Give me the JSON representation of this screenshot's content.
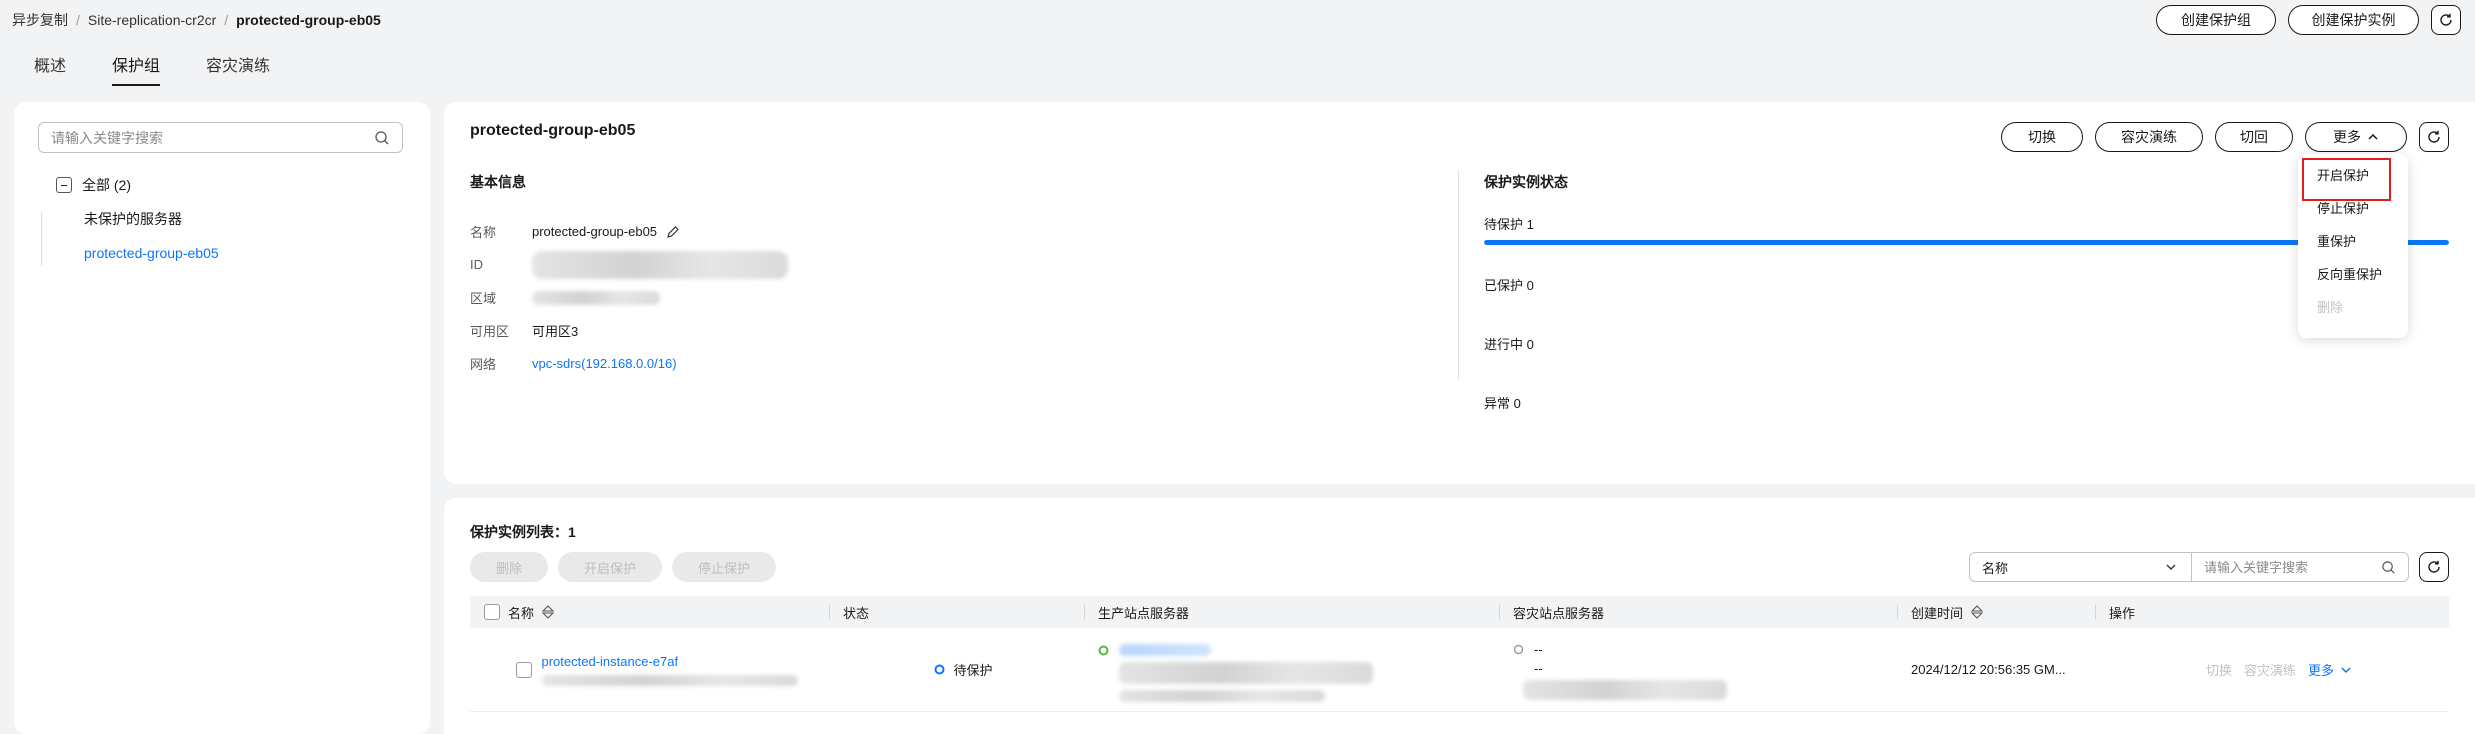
{
  "breadcrumb": [
    "异步复制",
    "Site-replication-cr2cr",
    "protected-group-eb05"
  ],
  "top_actions": {
    "create_group": "创建保护组",
    "create_instance": "创建保护实例"
  },
  "tabs": [
    {
      "label": "概述",
      "active": false
    },
    {
      "label": "保护组",
      "active": true
    },
    {
      "label": "容灾演练",
      "active": false
    }
  ],
  "sidebar": {
    "search_placeholder": "请输入关键字搜索",
    "tree": {
      "root_label": "全部 (2)",
      "children": [
        {
          "label": "未保护的服务器",
          "selected": false
        },
        {
          "label": "protected-group-eb05",
          "selected": true
        }
      ]
    }
  },
  "group": {
    "title": "protected-group-eb05",
    "actions": {
      "switch": "切换",
      "drill": "容灾演练",
      "failback": "切回",
      "more": "更多"
    },
    "basic_info": {
      "title": "基本信息",
      "fields": [
        {
          "label": "名称",
          "value": "protected-group-eb05",
          "editable": true
        },
        {
          "label": "ID",
          "value": "",
          "blurred": true
        },
        {
          "label": "区域",
          "value": "",
          "blurred": true
        },
        {
          "label": "可用区",
          "value": "可用区3"
        },
        {
          "label": "网络",
          "value": "vpc-sdrs(192.168.0.0/16)",
          "link": true
        }
      ]
    },
    "status": {
      "title": "保护实例状态",
      "items": [
        {
          "label": "待保护 1",
          "progress": 1.0
        },
        {
          "label": "已保护 0"
        },
        {
          "label": "进行中 0"
        },
        {
          "label": "异常 0"
        }
      ]
    },
    "more_menu": {
      "items": [
        {
          "label": "开启保护",
          "disabled": false,
          "highlighted": true
        },
        {
          "label": "停止保护",
          "disabled": false
        },
        {
          "label": "重保护",
          "disabled": false
        },
        {
          "label": "反向重保护",
          "disabled": false
        },
        {
          "label": "删除",
          "disabled": true
        }
      ]
    }
  },
  "instance_list": {
    "title": "保护实例列表：",
    "count": "1",
    "bulk_actions": {
      "delete": "删除",
      "start": "开启保护",
      "stop": "停止保护"
    },
    "filter": {
      "field": "名称",
      "placeholder": "请输入关键字搜索"
    },
    "columns": [
      "名称",
      "状态",
      "生产站点服务器",
      "容灾站点服务器",
      "创建时间",
      "操作"
    ],
    "rows": [
      {
        "name": "protected-instance-e7af",
        "status": "待保护",
        "dr_server": "--",
        "dr_server_sub": "--",
        "created": "2024/12/12 20:56:35 GM...",
        "ops": {
          "switch": "切换",
          "drill": "容灾演练",
          "more": "更多"
        }
      }
    ]
  },
  "colors": {
    "accent": "#0d76f7",
    "highlight_border": "#e01e1e",
    "status_pending": "#0d76f7",
    "status_ok": "#50b93b"
  }
}
